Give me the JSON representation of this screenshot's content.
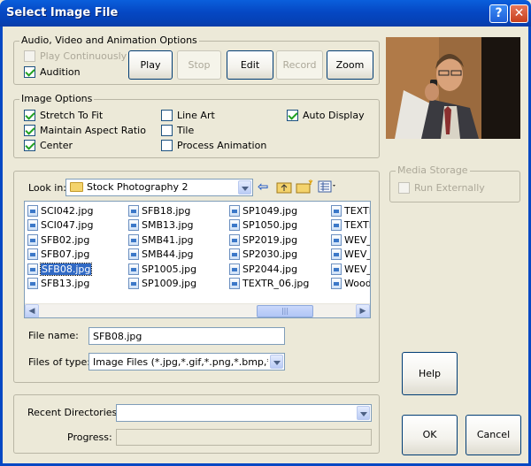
{
  "window": {
    "title": "Select Image File",
    "help_glyph": "?",
    "close_glyph": "✕"
  },
  "av_options": {
    "legend": "Audio, Video and Animation Options",
    "play_continuously": {
      "label": "Play Continuously",
      "checked": false,
      "enabled": false
    },
    "audition": {
      "label": "Audition",
      "checked": true
    },
    "buttons": {
      "play": "Play",
      "stop": "Stop",
      "edit": "Edit",
      "record": "Record",
      "zoom": "Zoom"
    }
  },
  "image_options": {
    "legend": "Image Options",
    "stretch_to_fit": {
      "label": "Stretch To Fit",
      "checked": true
    },
    "maintain_aspect": {
      "label": "Maintain Aspect Ratio",
      "checked": true
    },
    "center": {
      "label": "Center",
      "checked": true
    },
    "line_art": {
      "label": "Line Art",
      "checked": false
    },
    "tile": {
      "label": "Tile",
      "checked": false
    },
    "process_animation": {
      "label": "Process Animation",
      "checked": false
    },
    "auto_display": {
      "label": "Auto Display",
      "checked": true
    }
  },
  "media_storage": {
    "legend": "Media Storage",
    "run_externally": {
      "label": "Run Externally",
      "checked": false,
      "enabled": false
    }
  },
  "browser": {
    "look_in_label": "Look in:",
    "look_in_value": "Stock Photography 2",
    "columns": [
      [
        "SCI042.jpg",
        "SCI047.jpg",
        "SFB02.jpg",
        "SFB07.jpg",
        "SFB08.jpg",
        "SFB13.jpg"
      ],
      [
        "SFB18.jpg",
        "SMB13.jpg",
        "SMB41.jpg",
        "SMB44.jpg",
        "SP1005.jpg",
        "SP1009.jpg"
      ],
      [
        "SP1049.jpg",
        "SP1050.jpg",
        "SP2019.jpg",
        "SP2030.jpg",
        "SP2044.jpg",
        "TEXTR_06.jpg"
      ],
      [
        "TEXTR",
        "TEXTR",
        "WEV_",
        "WEV_",
        "WEV_",
        "Wood"
      ]
    ],
    "selected": "SFB08.jpg",
    "file_name_label": "File name:",
    "file_name_value": "SFB08.jpg",
    "files_of_type_label": "Files of type:",
    "files_of_type_value": "Image Files (*.jpg,*.gif,*.png,*.bmp,*.pcx,*.wn"
  },
  "recent": {
    "label": "Recent Directories:",
    "value": "",
    "progress_label": "Progress:"
  },
  "buttons": {
    "help": "Help",
    "ok": "OK",
    "cancel": "Cancel"
  },
  "icons": {
    "folder": "folder-icon",
    "back": "back-arrow-icon",
    "up": "up-folder-icon",
    "new_folder": "new-folder-icon",
    "view": "view-menu-icon"
  },
  "colors": {
    "titlebar": "#0548c4",
    "selection": "#316ac5",
    "face": "#ece9d8"
  }
}
